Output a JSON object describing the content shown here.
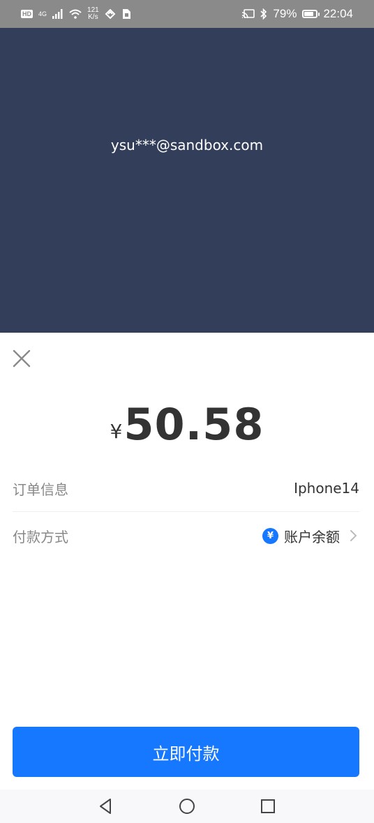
{
  "status_bar": {
    "hd": "HD",
    "network": "4G",
    "speed_value": "121",
    "speed_unit": "K/s",
    "battery": "79%",
    "time": "22:04"
  },
  "overlay": {
    "email": "ysu***@sandbox.com"
  },
  "payment": {
    "currency_symbol": "¥",
    "amount": "50.58",
    "order_label": "订单信息",
    "order_value": "Iphone14",
    "method_label": "付款方式",
    "method_icon_glyph": "¥",
    "method_value": "账户余额",
    "pay_button": "立即付款"
  },
  "colors": {
    "overlay_bg": "#333f5a",
    "accent": "#1677ff"
  },
  "icons": {
    "close": "close-icon",
    "chevron": "chevron-right-icon",
    "coin": "yuan-coin-icon",
    "nav_back": "triangle-back-icon",
    "nav_home": "circle-home-icon",
    "nav_recent": "square-recent-icon"
  }
}
